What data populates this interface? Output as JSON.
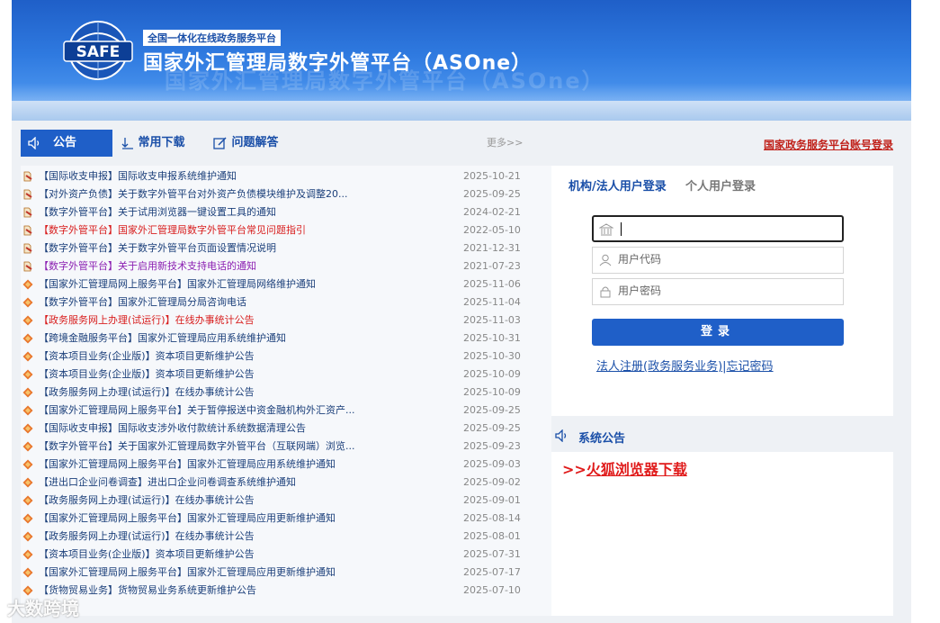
{
  "header": {
    "logo_text": "SAFE",
    "tagline": "全国一体化在线政务服务平台",
    "title": "国家外汇管理局数字外管平台（ASOne）",
    "watermark": "国家外汇管理局数字外管平台（ASOne）"
  },
  "tabs": {
    "notice": "公告",
    "downloads": "常用下载",
    "qa": "问题解答",
    "more": "更多>>"
  },
  "gov_login_link": "国家政务服务平台账号登录",
  "notices": [
    {
      "text": "【国际收支申报】国际收支申报系统维护通知",
      "date": "2025-10-21",
      "style": "normal",
      "icon": "pin-icon"
    },
    {
      "text": "【对外资产负债】关于数字外管平台对外资产负债模块维护及调整20...",
      "date": "2025-09-25",
      "style": "normal",
      "icon": "pin-icon"
    },
    {
      "text": "【数字外管平台】关于试用浏览器一键设置工具的通知",
      "date": "2024-02-21",
      "style": "normal",
      "icon": "pin-icon"
    },
    {
      "text": "【数字外管平台】国家外汇管理局数字外管平台常见问题指引",
      "date": "2022-05-10",
      "style": "red",
      "icon": "pin-icon"
    },
    {
      "text": "【数字外管平台】关于数字外管平台页面设置情况说明",
      "date": "2021-12-31",
      "style": "normal",
      "icon": "pin-icon"
    },
    {
      "text": "【数字外管平台】关于启用新技术支持电话的通知",
      "date": "2021-07-23",
      "style": "purple",
      "icon": "pin-icon"
    },
    {
      "text": "【国家外汇管理局网上服务平台】国家外汇管理局网络维护通知",
      "date": "2025-11-06",
      "style": "normal",
      "icon": "diamond-icon"
    },
    {
      "text": "【数字外管平台】国家外汇管理局分局咨询电话",
      "date": "2025-11-04",
      "style": "normal",
      "icon": "diamond-icon"
    },
    {
      "text": "【政务服务网上办理(试运行)】在线办事统计公告",
      "date": "2025-11-03",
      "style": "red",
      "icon": "diamond-icon"
    },
    {
      "text": "【跨境金融服务平台】国家外汇管理局应用系统维护通知",
      "date": "2025-10-31",
      "style": "normal",
      "icon": "diamond-icon"
    },
    {
      "text": "【资本项目业务(企业版)】资本项目更新维护公告",
      "date": "2025-10-30",
      "style": "normal",
      "icon": "diamond-icon"
    },
    {
      "text": "【资本项目业务(企业版)】资本项目更新维护公告",
      "date": "2025-10-09",
      "style": "normal",
      "icon": "diamond-icon"
    },
    {
      "text": "【政务服务网上办理(试运行)】在线办事统计公告",
      "date": "2025-10-09",
      "style": "normal",
      "icon": "diamond-icon"
    },
    {
      "text": "【国家外汇管理局网上服务平台】关于暂停报送中资金融机构外汇资产...",
      "date": "2025-09-25",
      "style": "normal",
      "icon": "diamond-icon"
    },
    {
      "text": "【国际收支申报】国际收支涉外收付款统计系统数据清理公告",
      "date": "2025-09-25",
      "style": "normal",
      "icon": "diamond-icon"
    },
    {
      "text": "【数字外管平台】关于国家外汇管理局数字外管平台（互联网端）浏览...",
      "date": "2025-09-23",
      "style": "normal",
      "icon": "diamond-icon"
    },
    {
      "text": "【国家外汇管理局网上服务平台】国家外汇管理局应用系统维护通知",
      "date": "2025-09-03",
      "style": "normal",
      "icon": "diamond-icon"
    },
    {
      "text": "【进出口企业问卷调查】进出口企业问卷调查系统维护通知",
      "date": "2025-09-02",
      "style": "normal",
      "icon": "diamond-icon"
    },
    {
      "text": "【政务服务网上办理(试运行)】在线办事统计公告",
      "date": "2025-09-01",
      "style": "normal",
      "icon": "diamond-icon"
    },
    {
      "text": "【国家外汇管理局网上服务平台】国家外汇管理局应用更新维护通知",
      "date": "2025-08-14",
      "style": "normal",
      "icon": "diamond-icon"
    },
    {
      "text": "【政务服务网上办理(试运行)】在线办事统计公告",
      "date": "2025-08-01",
      "style": "normal",
      "icon": "diamond-icon"
    },
    {
      "text": "【资本项目业务(企业版)】资本项目更新维护公告",
      "date": "2025-07-31",
      "style": "normal",
      "icon": "diamond-icon"
    },
    {
      "text": "【国家外汇管理局网上服务平台】国家外汇管理局应用更新维护通知",
      "date": "2025-07-17",
      "style": "normal",
      "icon": "diamond-icon"
    },
    {
      "text": "【货物贸易业务】货物贸易业务系统更新维护公告",
      "date": "2025-07-10",
      "style": "normal",
      "icon": "diamond-icon"
    }
  ],
  "login": {
    "tab_org": "机构/法人用户登录",
    "tab_personal": "个人用户登录",
    "org_value": "",
    "user_code_placeholder": "用户代码",
    "password_placeholder": "用户密码",
    "submit": "登录",
    "register_link": "法人注册(政务服务业务)",
    "separator": "|",
    "forgot_link": "忘记密码"
  },
  "system_notice": {
    "heading": "系统公告",
    "arrow": ">>",
    "firefox_link": "火狐浏览器下载"
  },
  "corner_watermark": "大数跨境",
  "colors": {
    "primary": "#1f5fc8",
    "link": "#1a4fa8",
    "alert_red": "#d81e1e",
    "purple": "#8b1fb2"
  }
}
